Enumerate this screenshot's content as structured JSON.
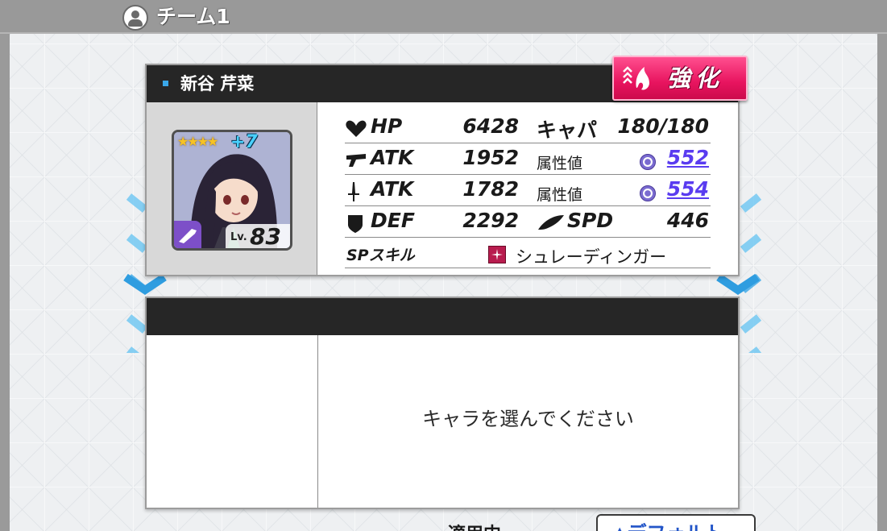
{
  "header": {
    "title": "チーム1",
    "icon": "team-icon"
  },
  "character": {
    "name": "新谷 芹菜",
    "rarity_stars": "★★★★",
    "plus": "+7",
    "level_prefix": "Lv.",
    "level": "83",
    "enhance_label": "強化"
  },
  "stats": {
    "hp_name": "HP",
    "hp_value": "6428",
    "capa_label": "キャパ",
    "capa_value": "180/180",
    "gun_atk_name": "ATK",
    "gun_atk_value": "1952",
    "gun_attr_label": "属性値",
    "gun_attr_value": "552",
    "blade_atk_name": "ATK",
    "blade_atk_value": "1782",
    "blade_attr_label": "属性値",
    "blade_attr_value": "554",
    "def_name": "DEF",
    "def_value": "2292",
    "spd_name": "SPD",
    "spd_value": "446",
    "sp_skill_label": "SPスキル",
    "sp_skill_name": "シュレーディンガー"
  },
  "empty_slot": {
    "message": "キャラを選んでください"
  },
  "bottom": {
    "applied_label": "適用中",
    "default_button": "▲デフォルト"
  },
  "colors": {
    "header_bg": "#999999",
    "panel_head_bg": "#262626",
    "enhance_pink": "#e8145f",
    "attr_purple": "#5a3cf0",
    "chevron_blue": "#4fb8ee"
  }
}
